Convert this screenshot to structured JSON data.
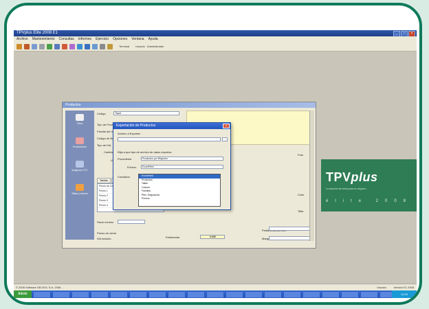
{
  "app": {
    "title": "TPVplus Élite 2008 E1",
    "window_controls": [
      "_",
      "□",
      "×"
    ]
  },
  "menubar": [
    "Archivo",
    "Mantenimiento",
    "Consultas",
    "Informes",
    "Ejercicio",
    "Opciones",
    "Ventana",
    "Ayuda"
  ],
  "toolbar": {
    "buttons": [
      {
        "icon": "user-icon",
        "color": "#d08a2a"
      },
      {
        "icon": "people-icon",
        "color": "#c05a2a"
      },
      {
        "icon": "box-icon",
        "color": "#7a9bd0"
      },
      {
        "icon": "document-icon",
        "color": "#9aa0a8"
      },
      {
        "icon": "gear-icon",
        "color": "#4aa04a"
      },
      {
        "icon": "chart-icon",
        "color": "#5a7ac0"
      },
      {
        "icon": "pencil-icon",
        "color": "#d05a3a"
      },
      {
        "icon": "palette-icon",
        "color": "#b06ad0"
      },
      {
        "icon": "globe-icon",
        "color": "#3a90d0"
      },
      {
        "icon": "chart-bar-icon",
        "color": "#3a70c0"
      },
      {
        "icon": "calc-icon",
        "color": "#6a9ad0"
      },
      {
        "icon": "tools-icon",
        "color": "#8a8a8a"
      },
      {
        "icon": "users-icon",
        "color": "#c09a3a"
      }
    ],
    "text_items": [
      "Terminal",
      "Usuario",
      "Administrador"
    ]
  },
  "status": {
    "left": "© 2008 Software DELSOL S.A. 2008 ...",
    "right1": "Usuario",
    "right2": "Versión E1 2008"
  },
  "taskbar": {
    "start": "Inicio",
    "tasks": [
      "",
      "",
      "",
      "",
      "",
      "",
      "",
      "",
      "",
      "",
      "",
      "",
      "",
      "",
      "",
      "",
      "",
      "",
      "",
      ""
    ],
    "tray": "12:00"
  },
  "main_window": {
    "title": "Productos",
    "side_buttons": [
      "Ficha",
      "Proveedores",
      "Imágenes TPV",
      "Tallas y colores"
    ],
    "labels": {
      "codigo": "Código",
      "codigo_value": "Tapa1",
      "tipo": "Tipo de Producto",
      "tipo_value": "Normal",
      "familia": "Familia del menú",
      "fecha": "Código de Barras",
      "iva": "Tipo de IVA",
      "iva_value": "IVA",
      "cantidad": "Cantidad",
      "ubicacion": "Ubicación",
      "ubicacion_value": "Por 10 en serie",
      "stock_min": "Stock mínimo",
      "stock_max": "Pedidos pendientes",
      "total": "Total",
      "total_value": "0.000",
      "margen": "Margen",
      "precio": "Precio de venta",
      "existencias": "Existencias",
      "pvp": "PVP",
      "iva_incl": "IVA incluido"
    },
    "tabs": [
      "Tarifas",
      "Escandallos"
    ],
    "grid_rows": [
      "Precio de Coste",
      "Precio 1",
      "Precio 2",
      "Precio 3",
      "Precio 4"
    ],
    "right_labels": [
      "Foto",
      "Color",
      "Talla"
    ]
  },
  "dialog": {
    "title": "Exportación de Productos",
    "close": "×",
    "archivo_label": "Archivo a Exportar",
    "archivo_value": "",
    "hint": "Elija a qué tipo de archivo de datos exportar:",
    "procedente_label": "Procedente",
    "procedente_value": "Productos por Régimen",
    "fichero_label": "Fichero",
    "fichero_value": "Excel/Html",
    "condicion_label": "Condición",
    "options": [
      "Excel/Html",
      "Productos",
      "Tallas",
      "Colores",
      "Familias",
      "Ptes. Regulación",
      "Precios"
    ]
  },
  "promo": {
    "brand_prefix": "TPV",
    "brand_suffix": "plus",
    "tagline": "La solución de venta para su negocio ...",
    "bottom": "élite 2008"
  }
}
